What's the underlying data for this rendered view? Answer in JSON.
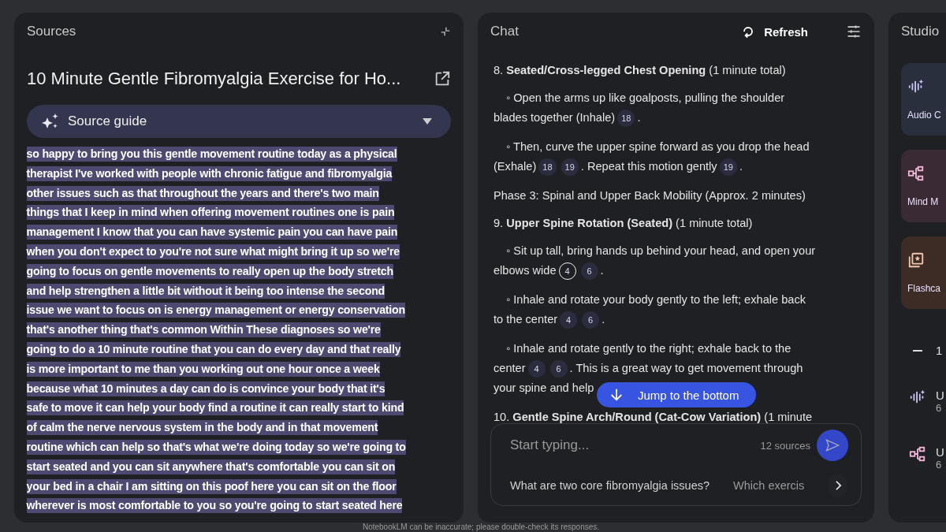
{
  "sources": {
    "title": "Sources",
    "source_title": "10 Minute Gentle Fibromyalgia Exercise for Ho...",
    "guide": {
      "label": "Source guide",
      "expanded": false
    },
    "transcript_lines": [
      "so happy to bring you this gentle movement routine today as a physical",
      "therapist I've worked with people with chronic fatigue and fibromyalgia",
      "other issues such as that throughout the years and there's two main",
      "things that I keep in mind when offering movement routines one is pain",
      "management I know that you can have systemic pain you can have pain",
      "when you don't expect to you're not sure what might bring it up so we're",
      "going to focus on gentle movements to really open up the body stretch",
      "and help strengthen a little bit without it being too intense the second",
      "issue we want to focus on is energy management or energy conservation",
      "that's another thing that's common Within These diagnoses so we're",
      "going to do a 10 minute routine that you can do every day and that really",
      "is more important to me than you working out one hour once a week",
      "because what 10 minutes a day can do is convince your body that it's",
      "safe to move it can help your body find a routine it can really start to kind",
      "of calm the nerve nervous system in the body and in that movement",
      "routine which can help so that's what we're doing today so we're going to",
      "start seated and you can sit anywhere that's comfortable you can sit on",
      "your bed in a chair I am sitting on this poof here you can sit on the floor",
      "wherever is most comfortable to you so you're going to start seated here"
    ]
  },
  "chat": {
    "title": "Chat",
    "refresh": "Refresh",
    "blocks": [
      {
        "kind": "heading",
        "text": "8. **Seated/Cross-legged Chest Opening** (1 minute total)"
      },
      {
        "kind": "bullet",
        "lines": [
          [
            {
              "kind": "text",
              "text": "◦ Open the arms up like goalposts, pulling the shoulder"
            }
          ],
          [
            {
              "kind": "text",
              "text": "blades together (Inhale)"
            },
            {
              "kind": "citation",
              "text": "18",
              "selected": false
            },
            {
              "kind": "text",
              "text": "."
            }
          ]
        ]
      },
      {
        "kind": "bullet",
        "lines": [
          [
            {
              "kind": "text",
              "text": "◦ Then, curve the upper spine forward as you drop the head"
            }
          ],
          [
            {
              "kind": "text",
              "text": "(Exhale)"
            },
            {
              "kind": "citation",
              "text": "18",
              "selected": false
            },
            {
              "kind": "citation",
              "text": "19",
              "selected": false
            },
            {
              "kind": "text",
              "text": ". Repeat this motion gently"
            },
            {
              "kind": "citation",
              "text": "19",
              "selected": false
            },
            {
              "kind": "text",
              "text": "."
            }
          ]
        ]
      },
      {
        "kind": "plain",
        "text": "Phase 3: Spinal and Upper Back Mobility (Approx. 2 minutes)"
      },
      {
        "kind": "heading",
        "text": "9. **Upper Spine Rotation (Seated)** (1 minute total)"
      },
      {
        "kind": "bullet",
        "lines": [
          [
            {
              "kind": "text",
              "text": "◦ Sit up tall, bring hands up behind your head, and open your"
            }
          ],
          [
            {
              "kind": "text",
              "text": "elbows wide"
            },
            {
              "kind": "citation",
              "text": "4",
              "selected": true
            },
            {
              "kind": "citation",
              "text": "6",
              "selected": false
            },
            {
              "kind": "text",
              "text": "."
            }
          ]
        ]
      },
      {
        "kind": "bullet",
        "lines": [
          [
            {
              "kind": "text",
              "text": "◦ Inhale and rotate your body gently to the left; exhale back"
            }
          ],
          [
            {
              "kind": "text",
              "text": "to the center"
            },
            {
              "kind": "citation",
              "text": "4",
              "selected": false
            },
            {
              "kind": "citation",
              "text": "6",
              "selected": false
            },
            {
              "kind": "text",
              "text": "."
            }
          ]
        ]
      },
      {
        "kind": "bullet",
        "lines": [
          [
            {
              "kind": "text",
              "text": "◦ Inhale and rotate gently to the right; exhale back to the"
            }
          ],
          [
            {
              "kind": "text",
              "text": "center"
            },
            {
              "kind": "citation",
              "text": "4",
              "selected": false
            },
            {
              "kind": "citation",
              "text": "6",
              "selected": false
            },
            {
              "kind": "text",
              "text": ". This is a great way to get movement through"
            }
          ],
          [
            {
              "kind": "text",
              "text": "your spine and help"
            }
          ]
        ]
      },
      {
        "kind": "heading",
        "text": "10. **Gentle Spine Arch/Round (Cat-Cow Variation)** (1 minute"
      }
    ],
    "jump_button": "Jump to the bottom",
    "input": {
      "placeholder": "Start typing...",
      "source_count": "12 sources"
    },
    "suggestions": [
      "What are two core fibromyalgia issues?",
      "Which exercis"
    ]
  },
  "studio": {
    "title": "Studio",
    "cards": [
      {
        "kind": "audio",
        "label": "Audio C",
        "color": "#2a2f3d"
      },
      {
        "kind": "mindmap",
        "label": "Mind M",
        "color": "#3a2a33"
      },
      {
        "kind": "flashcards",
        "label": "Flashca",
        "color": "#3d2c26"
      }
    ],
    "items": [
      {
        "kind": "note",
        "title": "1"
      },
      {
        "kind": "audio",
        "title": "U",
        "meta": "6"
      },
      {
        "kind": "mindmap",
        "title": "U",
        "meta": "6"
      }
    ]
  },
  "footer": "NotebookLM can be inaccurate; please double-check its responses."
}
